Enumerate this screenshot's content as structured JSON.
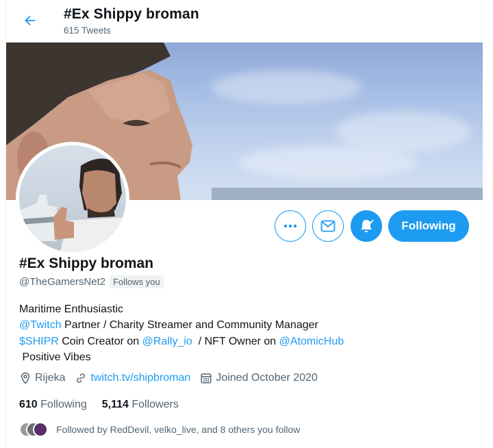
{
  "header": {
    "title": "#Ex Shippy broman",
    "tweet_count": "615 Tweets"
  },
  "actions": {
    "more_icon": "ellipsis-icon",
    "message_icon": "envelope-icon",
    "notify_icon": "bell-check-icon",
    "following_label": "Following"
  },
  "profile": {
    "name": "#Ex Shippy broman",
    "handle": "@TheGamersNet2",
    "follows_you": "Follows you",
    "bio": {
      "line1": "Maritime Enthusiastic",
      "line2_link": "@Twitch",
      "line2_text": " Partner / Charity Streamer and Community Manager",
      "line3_link1": "$SHIPR",
      "line3_text1": " Coin Creator on ",
      "line3_link2": "@Rally_io",
      "line3_text2": "  / NFT Owner on ",
      "line3_link3": "@AtomicHub",
      "line4": " Positive Vibes"
    },
    "location": "Rijeka",
    "website": "twitch.tv/shipbroman",
    "joined": "Joined October 2020",
    "following_count": "610",
    "following_label": "Following",
    "followers_count": "5,114",
    "followers_label": "Followers",
    "followed_by": "Followed by RedDevil, velko_live, and 8 others you follow"
  },
  "colors": {
    "accent": "#1d9bf0",
    "text_primary": "#0f1419",
    "text_secondary": "#536471"
  }
}
